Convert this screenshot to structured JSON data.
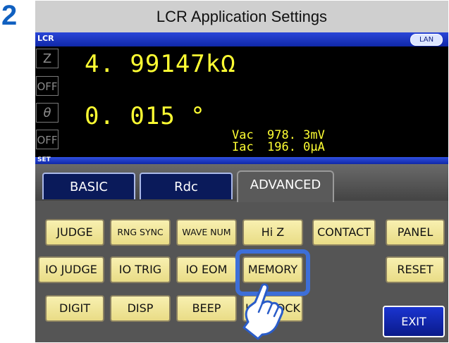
{
  "step": {
    "number": "2"
  },
  "window": {
    "title": "LCR Application Settings"
  },
  "status_bar": {
    "mode_label": "LCR",
    "lan_badge": "LAN"
  },
  "measurement": {
    "primary": {
      "param": "Z",
      "value": "4. 99147kΩ",
      "comparator": "OFF"
    },
    "secondary": {
      "param": "θ",
      "value": "0. 015 °",
      "comparator": "OFF"
    },
    "monitors": [
      {
        "label": "Vac",
        "value": "978. 3mV"
      },
      {
        "label": "Iac",
        "value": "196. 0μA"
      }
    ]
  },
  "set_bar": {
    "label": "SET"
  },
  "tabs": [
    {
      "label": "BASIC",
      "active": false
    },
    {
      "label": "Rdc",
      "active": false
    },
    {
      "label": "ADVANCED",
      "active": true
    }
  ],
  "buttons": {
    "judge": "JUDGE",
    "rng_sync": "RNG SYNC",
    "wave_num": "WAVE NUM",
    "hi_z": "Hi Z",
    "contact": "CONTACT",
    "panel": "PANEL",
    "io_judge": "IO JUDGE",
    "io_trig": "IO TRIG",
    "io_eom": "IO EOM",
    "memory": "MEMORY",
    "reset": "RESET",
    "digit": "DIGIT",
    "disp": "DISP",
    "beep": "BEEP",
    "key_lock": "KEY LOCK",
    "exit": "EXIT"
  },
  "colors": {
    "accent_blue": "#1060c0",
    "readout_yellow": "#ffff33",
    "button_yellow": "#f3e9a0",
    "highlight": "#3d6fd8"
  },
  "icons": {
    "pointer": "pointing-hand-icon"
  }
}
